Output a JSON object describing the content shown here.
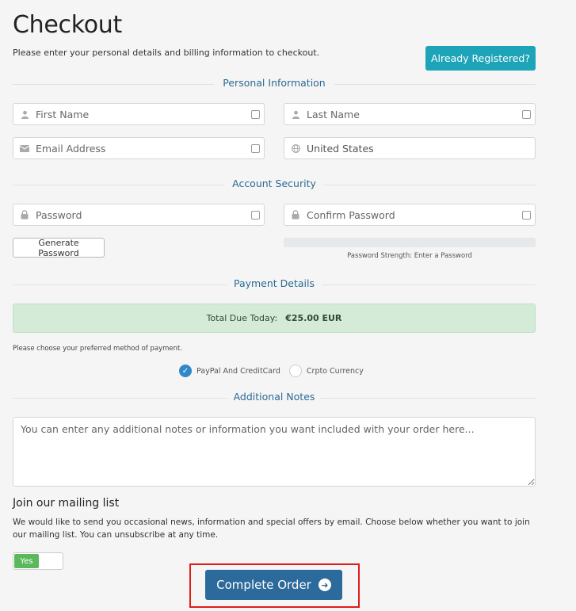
{
  "header": {
    "title": "Checkout",
    "subtitle": "Please enter your personal details and billing information to checkout.",
    "already_registered": "Already Registered?"
  },
  "sections": {
    "personal": "Personal Information",
    "security": "Account Security",
    "payment": "Payment Details",
    "notes": "Additional Notes"
  },
  "personal": {
    "first_name_placeholder": "First Name",
    "last_name_placeholder": "Last Name",
    "email_placeholder": "Email Address",
    "country_value": "United States"
  },
  "security": {
    "password_placeholder": "Password",
    "confirm_placeholder": "Confirm Password",
    "generate_label": "Generate Password",
    "strength_text": "Password Strength: Enter a Password"
  },
  "payment": {
    "total_label": "Total Due Today:",
    "total_amount": "€25.00 EUR",
    "choose_text": "Please choose your preferred method of payment.",
    "methods": [
      {
        "label": "PayPal And CreditCard",
        "selected": true
      },
      {
        "label": "Crpto Currency",
        "selected": false
      }
    ]
  },
  "notes": {
    "placeholder": "You can enter any additional notes or information you want included with your order here..."
  },
  "mailing": {
    "title": "Join our mailing list",
    "text": "We would like to send you occasional news, information and special offers by email. Choose below whether you want to join our mailing list. You can unsubscribe at any time.",
    "toggle_label": "Yes",
    "toggle_on": true
  },
  "actions": {
    "complete_label": "Complete Order"
  },
  "colors": {
    "accent": "#1ea4b9",
    "primary": "#2d6a9c",
    "section_text": "#2b6a95",
    "success_bg": "#d4ebd8",
    "highlight": "#e01d1d"
  }
}
